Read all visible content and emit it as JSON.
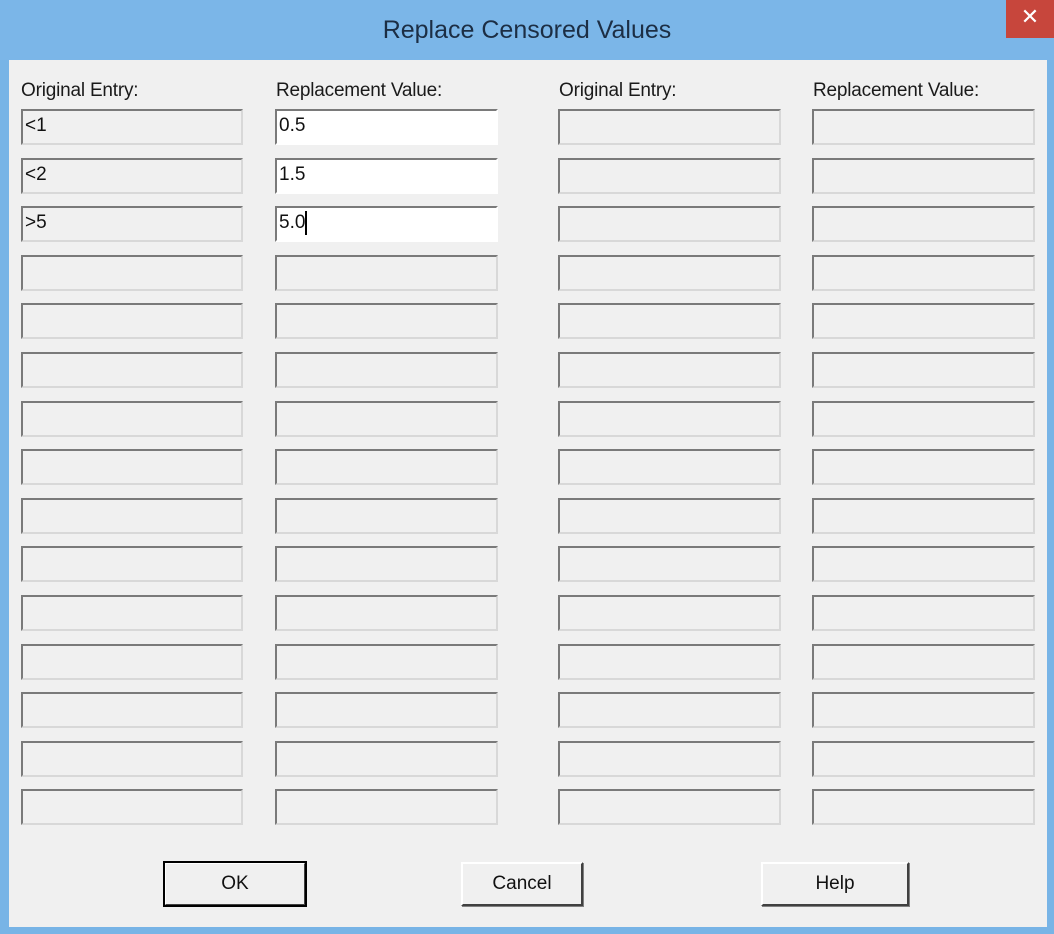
{
  "window": {
    "title": "Replace Censored Values",
    "close_glyph": "✕"
  },
  "headers": {
    "left_original": "Original Entry:",
    "left_replacement": "Replacement Value:",
    "right_original": "Original Entry:",
    "right_replacement": "Replacement Value:"
  },
  "left_rows": [
    {
      "original": "<1",
      "replacement": "0.5"
    },
    {
      "original": "<2",
      "replacement": "1.5"
    },
    {
      "original": ">5",
      "replacement": "5.0"
    },
    {
      "original": "",
      "replacement": ""
    },
    {
      "original": "",
      "replacement": ""
    },
    {
      "original": "",
      "replacement": ""
    },
    {
      "original": "",
      "replacement": ""
    },
    {
      "original": "",
      "replacement": ""
    },
    {
      "original": "",
      "replacement": ""
    },
    {
      "original": "",
      "replacement": ""
    },
    {
      "original": "",
      "replacement": ""
    },
    {
      "original": "",
      "replacement": ""
    },
    {
      "original": "",
      "replacement": ""
    },
    {
      "original": "",
      "replacement": ""
    },
    {
      "original": "",
      "replacement": ""
    }
  ],
  "right_rows": [
    {
      "original": "",
      "replacement": ""
    },
    {
      "original": "",
      "replacement": ""
    },
    {
      "original": "",
      "replacement": ""
    },
    {
      "original": "",
      "replacement": ""
    },
    {
      "original": "",
      "replacement": ""
    },
    {
      "original": "",
      "replacement": ""
    },
    {
      "original": "",
      "replacement": ""
    },
    {
      "original": "",
      "replacement": ""
    },
    {
      "original": "",
      "replacement": ""
    },
    {
      "original": "",
      "replacement": ""
    },
    {
      "original": "",
      "replacement": ""
    },
    {
      "original": "",
      "replacement": ""
    },
    {
      "original": "",
      "replacement": ""
    },
    {
      "original": "",
      "replacement": ""
    },
    {
      "original": "",
      "replacement": ""
    }
  ],
  "buttons": {
    "ok": "OK",
    "cancel": "Cancel",
    "help": "Help"
  },
  "colors": {
    "titlebar": "#7bb6e8",
    "close": "#c7463c",
    "dialog_bg": "#f0f0f0"
  }
}
